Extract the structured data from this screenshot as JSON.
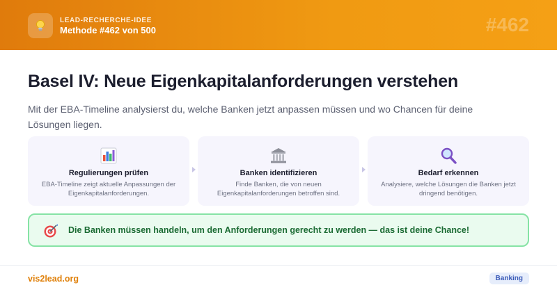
{
  "header": {
    "icon": "lightbulb-icon",
    "kicker": "LEAD-RECHERCHE-IDEE",
    "title": "Methode #462 von 500",
    "number": "#462"
  },
  "main": {
    "title": "Basel IV: Neue Eigenkapitalanforderungen verstehen",
    "subtitle": "Mit der EBA-Timeline analysierst du, welche Banken jetzt anpassen müssen und wo Chancen für deine Lösungen liegen."
  },
  "steps": [
    {
      "icon": "bar-chart-icon",
      "title": "Regulierungen prüfen",
      "desc": "EBA-Timeline zeigt aktuelle Anpassungen der Eigenkapitalanforderungen."
    },
    {
      "icon": "bank-building-icon",
      "title": "Banken identifizieren",
      "desc": "Finde Banken, die von neuen Eigenkapitalanforderungen betroffen sind."
    },
    {
      "icon": "magnifier-icon",
      "title": "Bedarf erkennen",
      "desc": "Analysiere, welche Lösungen die Banken jetzt dringend benötigen."
    }
  ],
  "callout": {
    "icon": "target-icon",
    "text": "Die Banken müssen handeln, um den Anforderungen gerecht zu werden — das ist deine Chance!"
  },
  "footer": {
    "brand": "vis2lead.org",
    "tag": "Banking"
  },
  "colors": {
    "header_start": "#e07b0c",
    "header_end": "#f5a015",
    "callout_bg": "#eafbef",
    "callout_border": "#86e3a5",
    "callout_text": "#1b6b33",
    "brand": "#e0820d",
    "tag_bg": "#e6edfb",
    "tag_text": "#3b5bb8"
  }
}
